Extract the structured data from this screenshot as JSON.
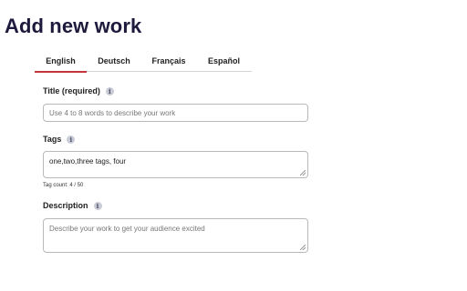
{
  "page": {
    "title": "Add new work"
  },
  "tabs": [
    {
      "label": "English",
      "active": true
    },
    {
      "label": "Deutsch",
      "active": false
    },
    {
      "label": "Français",
      "active": false
    },
    {
      "label": "Español",
      "active": false
    }
  ],
  "form": {
    "title_field": {
      "label": "Title (required)",
      "placeholder": "Use 4 to 8 words to describe your work",
      "value": ""
    },
    "tags_field": {
      "label": "Tags",
      "value": "one,two,three tags, four",
      "tag_count_label": "Tag count:",
      "tag_count_value": "4 / 50"
    },
    "description_field": {
      "label": "Description",
      "placeholder": "Describe your work to get your audience excited",
      "value": ""
    }
  },
  "icons": {
    "info": "info-icon"
  },
  "colors": {
    "title": "#1d1a3d",
    "active_tab_underline": "#c6343b",
    "border": "#b9b9b9"
  }
}
